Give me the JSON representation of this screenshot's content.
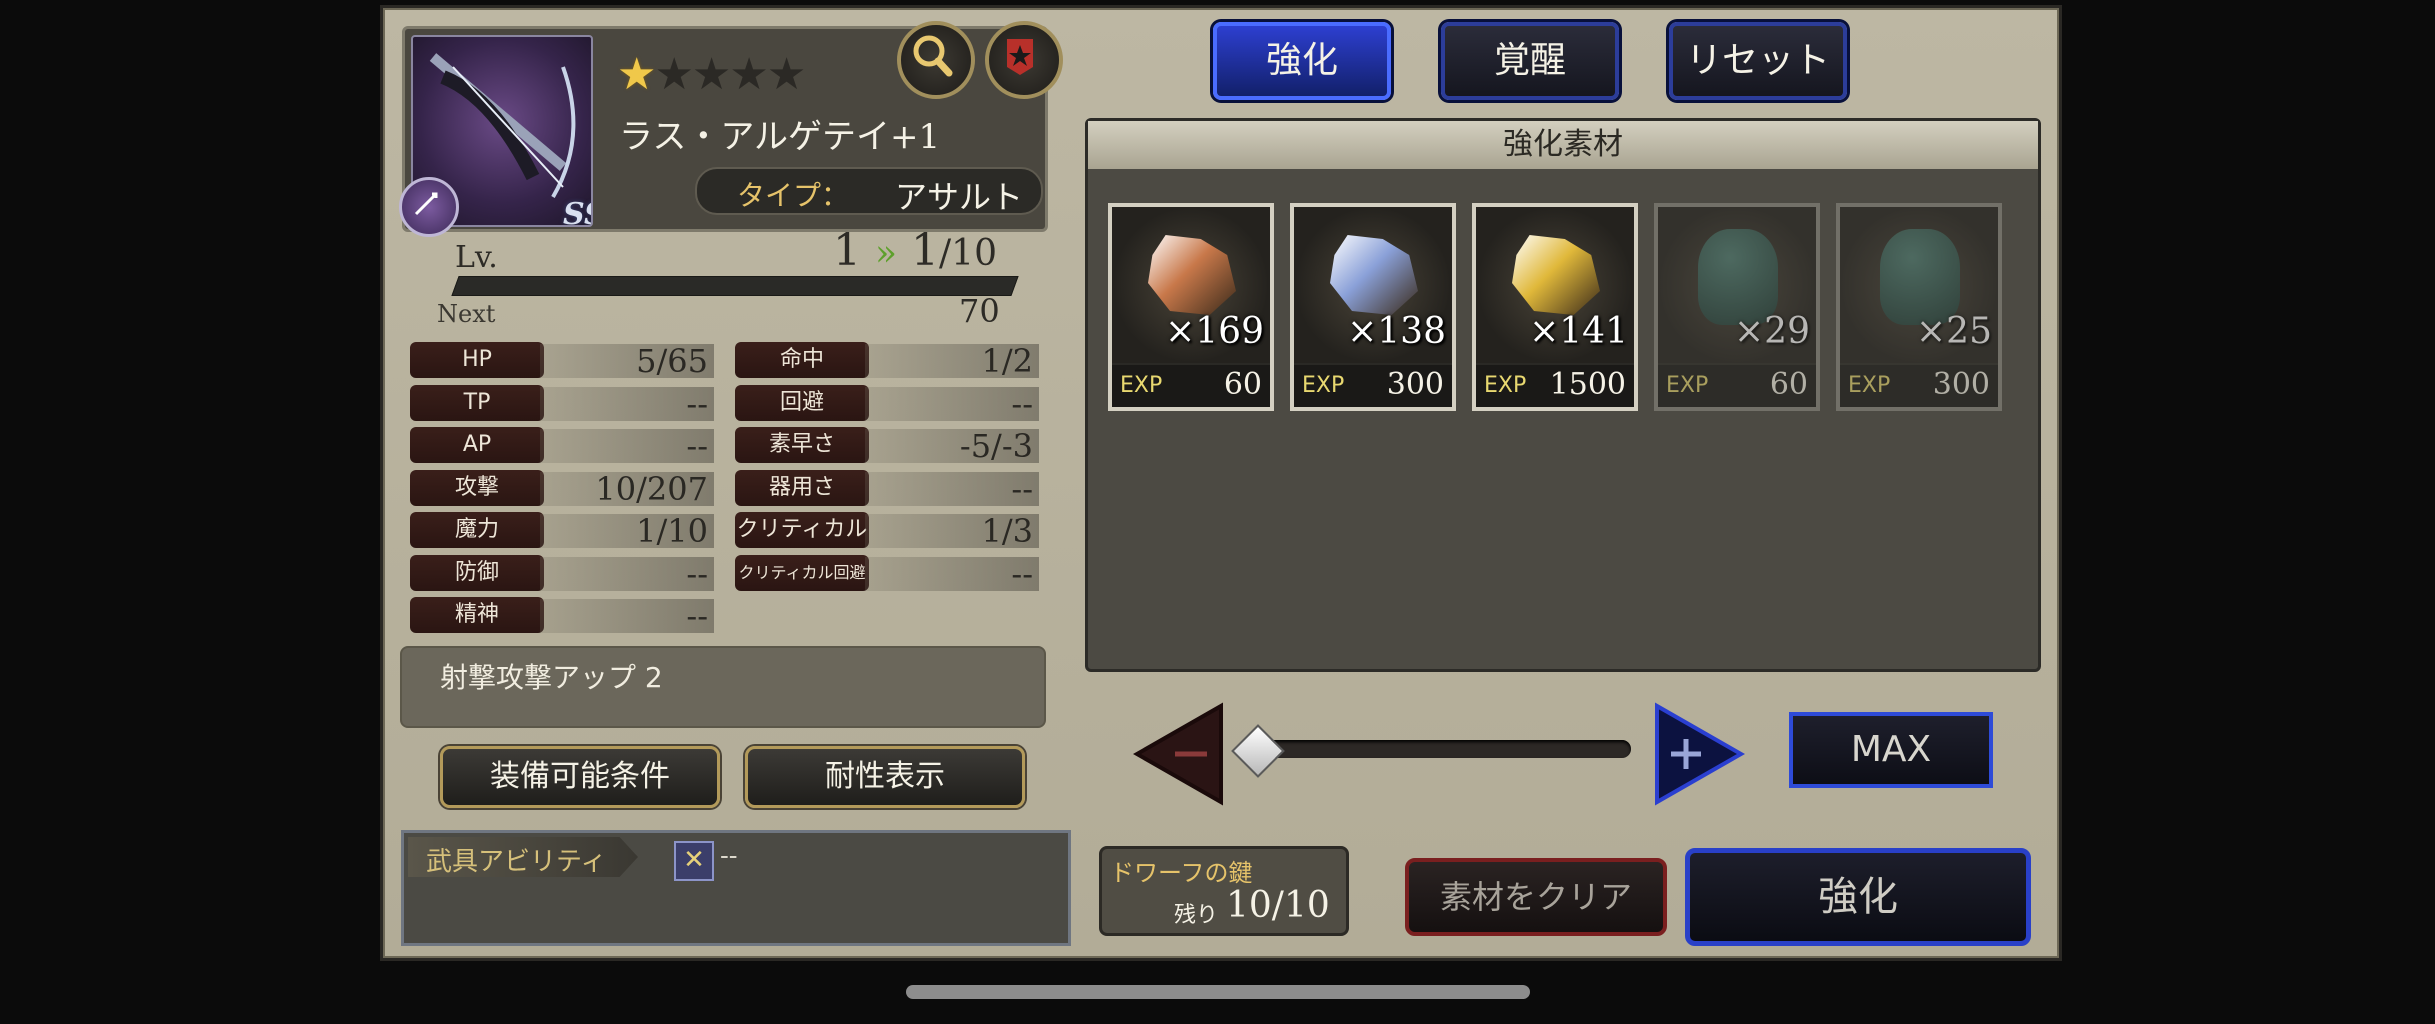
{
  "weapon": {
    "name": "ラス・アルゲテイ+1",
    "rarity": "SSR",
    "stars_total": 5,
    "stars_filled": 1,
    "type_label": "タイプ：",
    "type_value": "アサルト"
  },
  "level": {
    "label": "Lv.",
    "current": "1",
    "after": "1",
    "max": "/10",
    "next_label": "Next",
    "next_value": "70"
  },
  "stats_left": [
    {
      "label": "HP",
      "value": "5/65"
    },
    {
      "label": "TP",
      "value": "--"
    },
    {
      "label": "AP",
      "value": "--"
    },
    {
      "label": "攻撃",
      "value": "10/207"
    },
    {
      "label": "魔力",
      "value": "1/10"
    },
    {
      "label": "防御",
      "value": "--"
    },
    {
      "label": "精神",
      "value": "--"
    }
  ],
  "stats_right": [
    {
      "label": "命中",
      "value": "1/2"
    },
    {
      "label": "回避",
      "value": "--"
    },
    {
      "label": "素早さ",
      "value": "-5/-3"
    },
    {
      "label": "器用さ",
      "value": "--"
    },
    {
      "label": "クリティカル",
      "value": "1/3"
    },
    {
      "label": "クリティカル回避",
      "value": "--"
    }
  ],
  "skill": "射撃攻撃アップ 2",
  "buttons": {
    "equip_conditions": "装備可能条件",
    "resistance": "耐性表示",
    "max": "MAX",
    "clear": "素材をクリア",
    "enhance": "強化"
  },
  "ability": {
    "label": "武具アビリティ",
    "value": "--"
  },
  "tabs": [
    {
      "label": "強化",
      "active": true
    },
    {
      "label": "覚醒",
      "active": false
    },
    {
      "label": "リセット",
      "active": false
    }
  ],
  "materials_header": "強化素材",
  "materials": [
    {
      "count": "×169",
      "exp_label": "EXP",
      "exp": "60",
      "color": "#c8784a",
      "kind": "crystal",
      "dim": false
    },
    {
      "count": "×138",
      "exp_label": "EXP",
      "exp": "300",
      "color": "#8aa0d8",
      "kind": "crystal",
      "dim": false
    },
    {
      "count": "×141",
      "exp_label": "EXP",
      "exp": "1500",
      "color": "#e0b83a",
      "kind": "crystal",
      "dim": false
    },
    {
      "count": "×29",
      "exp_label": "EXP",
      "exp": "60",
      "color": "#4f7f74",
      "kind": "urn",
      "dim": true
    },
    {
      "count": "×25",
      "exp_label": "EXP",
      "exp": "300",
      "color": "#4f7f74",
      "kind": "urn",
      "dim": true
    }
  ],
  "slider": {
    "value_fraction": 0.0
  },
  "key": {
    "title": "ドワーフの鍵",
    "remain_label": "残り",
    "remain_value": "10/10"
  },
  "colors": {
    "panel": "#b7b19c",
    "tab_active": "#2d3fd0",
    "gold_text": "#e6c36a"
  }
}
